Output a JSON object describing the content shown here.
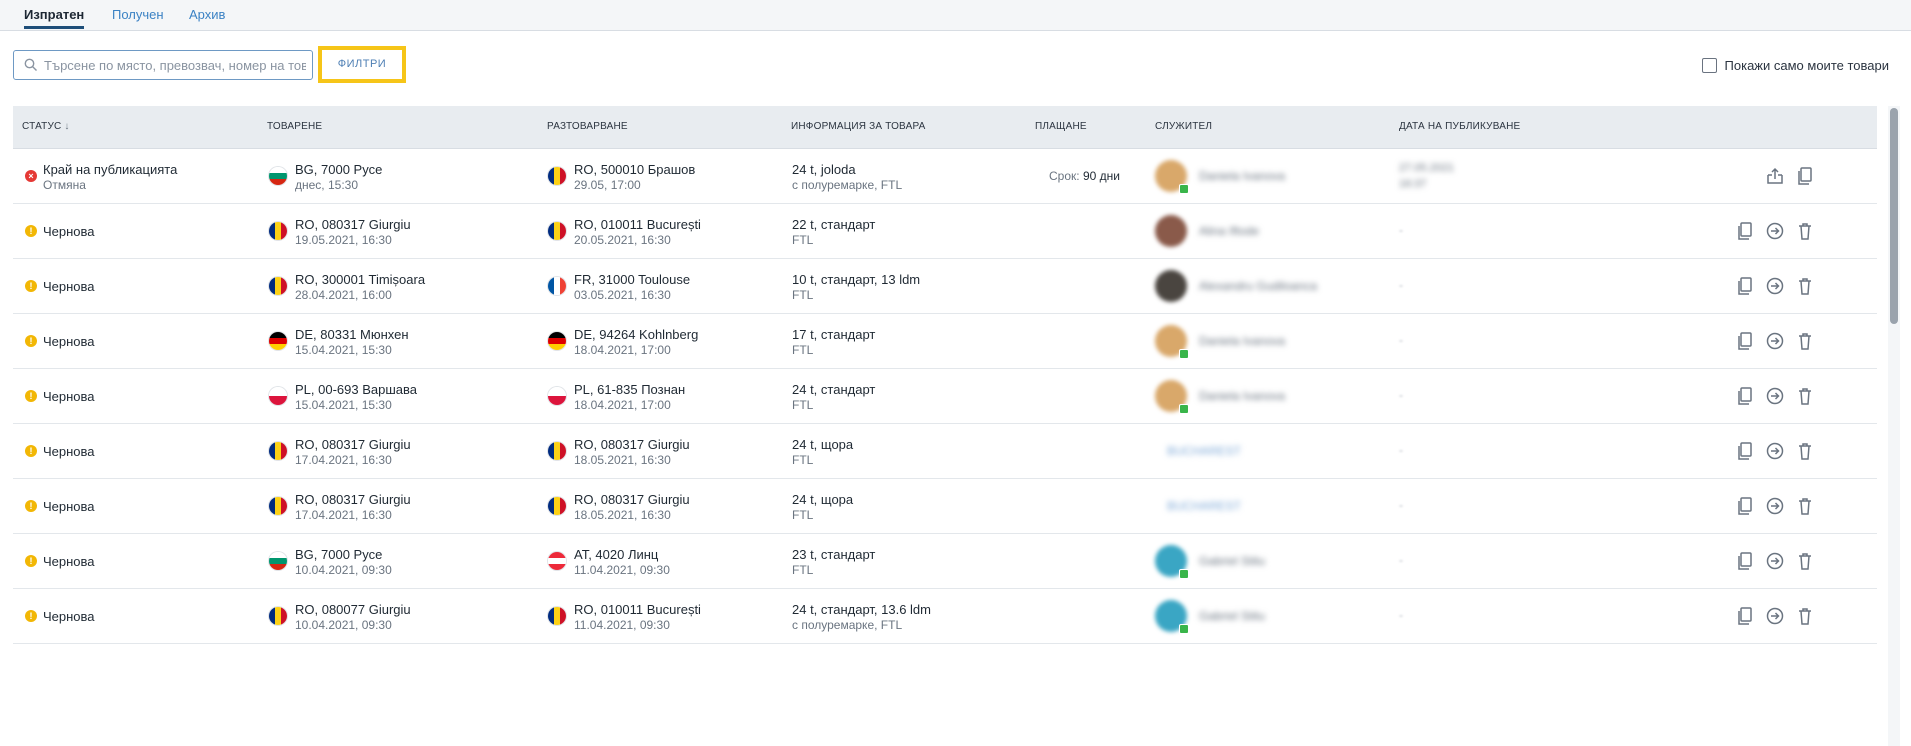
{
  "tabs": [
    {
      "label": "Изпратен",
      "active": true
    },
    {
      "label": "Получен",
      "active": false
    },
    {
      "label": "Архив",
      "active": false
    }
  ],
  "toolbar": {
    "search_placeholder": "Търсене по място, превозвач, номер на товар...",
    "search_value": "",
    "filters_label": "ФИЛТРИ",
    "show_mine_label": "Покажи само моите товари",
    "show_mine_checked": false
  },
  "table": {
    "headers": {
      "status": "СТАТУС",
      "loading": "ТОВАРЕНЕ",
      "unloading": "РАЗТОВАРВАНЕ",
      "cargo": "ИНФОРМАЦИЯ ЗА ТОВАРА",
      "payment": "ПЛАЩАНЕ",
      "employee": "СЛУЖИТЕЛ",
      "published": "ДАТА НА ПУБЛИКУВАНЕ"
    },
    "sort_indicator": "↓",
    "rows": [
      {
        "status": "Край на публикацията",
        "status_sub": "Отмяна",
        "status_type": "error",
        "load": "BG, 7000 Русе",
        "load_date": "днес, 15:30",
        "load_flag": "bg",
        "unload": "RO, 500010 Брашов",
        "unload_date": "29.05, 17:00",
        "unload_flag": "ro",
        "cargo": "24 t, joloda",
        "cargo_sub": "с полуремарке, FTL",
        "payment_label": "Срок:",
        "payment_value": "90 дни",
        "employee": "Daniela Ivanova",
        "employee_avatar": "#d9a86a",
        "employee_online": true,
        "published": "27.05.2021",
        "published_time": "16:37",
        "actions": [
          "repost-icon",
          "copy-icon"
        ]
      },
      {
        "status": "Чернова",
        "status_sub": "",
        "status_type": "warning",
        "load": "RO, 080317 Giurgiu",
        "load_date": "19.05.2021, 16:30",
        "load_flag": "ro",
        "unload": "RO, 010011 București",
        "unload_date": "20.05.2021, 16:30",
        "unload_flag": "ro",
        "cargo": "22 t, стандарт",
        "cargo_sub": "FTL",
        "payment_label": "",
        "payment_value": "",
        "employee": "Alina Iftode",
        "employee_avatar": "#8a5a4a",
        "employee_online": false,
        "published": "-",
        "published_time": "",
        "actions": [
          "copy-icon",
          "publish-icon",
          "delete-icon"
        ]
      },
      {
        "status": "Чернова",
        "status_sub": "",
        "status_type": "warning",
        "load": "RO, 300001 Timișoara",
        "load_date": "28.04.2021, 16:00",
        "load_flag": "ro",
        "unload": "FR, 31000 Toulouse",
        "unload_date": "03.05.2021, 16:30",
        "unload_flag": "fr",
        "cargo": "10 t, стандарт, 13 ldm",
        "cargo_sub": "FTL",
        "payment_label": "",
        "payment_value": "",
        "employee": "Alexandru Gudiloanca",
        "employee_avatar": "#4a4540",
        "employee_online": false,
        "published": "-",
        "published_time": "",
        "actions": [
          "copy-icon",
          "publish-icon",
          "delete-icon"
        ]
      },
      {
        "status": "Чернова",
        "status_sub": "",
        "status_type": "warning",
        "load": "DE, 80331 Мюнхен",
        "load_date": "15.04.2021, 15:30",
        "load_flag": "de",
        "unload": "DE, 94264 Kohlnberg",
        "unload_date": "18.04.2021, 17:00",
        "unload_flag": "de",
        "cargo": "17 t, стандарт",
        "cargo_sub": "FTL",
        "payment_label": "",
        "payment_value": "",
        "employee": "Daniela Ivanova",
        "employee_avatar": "#d9a86a",
        "employee_online": true,
        "published": "-",
        "published_time": "",
        "actions": [
          "copy-icon",
          "publish-icon",
          "delete-icon"
        ]
      },
      {
        "status": "Чернова",
        "status_sub": "",
        "status_type": "warning",
        "load": "PL, 00-693 Варшава",
        "load_date": "15.04.2021, 15:30",
        "load_flag": "pl",
        "unload": "PL, 61-835 Познан",
        "unload_date": "18.04.2021, 17:00",
        "unload_flag": "pl",
        "cargo": "24 t, стандарт",
        "cargo_sub": "FTL",
        "payment_label": "",
        "payment_value": "",
        "employee": "Daniela Ivanova",
        "employee_avatar": "#d9a86a",
        "employee_online": true,
        "published": "-",
        "published_time": "",
        "actions": [
          "copy-icon",
          "publish-icon",
          "delete-icon"
        ]
      },
      {
        "status": "Чернова",
        "status_sub": "",
        "status_type": "warning",
        "load": "RO, 080317 Giurgiu",
        "load_date": "17.04.2021, 16:30",
        "load_flag": "ro",
        "unload": "RO, 080317 Giurgiu",
        "unload_date": "18.05.2021, 16:30",
        "unload_flag": "ro",
        "cargo": "24 t, щора",
        "cargo_sub": "FTL",
        "payment_label": "",
        "payment_value": "",
        "employee": "BUCHAREST",
        "employee_avatar": "",
        "employee_online": false,
        "published": "-",
        "published_time": "",
        "actions": [
          "copy-icon",
          "publish-icon",
          "delete-icon"
        ]
      },
      {
        "status": "Чернова",
        "status_sub": "",
        "status_type": "warning",
        "load": "RO, 080317 Giurgiu",
        "load_date": "17.04.2021, 16:30",
        "load_flag": "ro",
        "unload": "RO, 080317 Giurgiu",
        "unload_date": "18.05.2021, 16:30",
        "unload_flag": "ro",
        "cargo": "24 t, щора",
        "cargo_sub": "FTL",
        "payment_label": "",
        "payment_value": "",
        "employee": "BUCHAREST",
        "employee_avatar": "",
        "employee_online": false,
        "published": "-",
        "published_time": "",
        "actions": [
          "copy-icon",
          "publish-icon",
          "delete-icon"
        ]
      },
      {
        "status": "Чернова",
        "status_sub": "",
        "status_type": "warning",
        "load": "BG, 7000 Русе",
        "load_date": "10.04.2021, 09:30",
        "load_flag": "bg",
        "unload": "AT, 4020 Линц",
        "unload_date": "11.04.2021, 09:30",
        "unload_flag": "at",
        "cargo": "23 t, стандарт",
        "cargo_sub": "FTL",
        "payment_label": "",
        "payment_value": "",
        "employee": "Gabriel Stitu",
        "employee_avatar": "#3aa6c4",
        "employee_online": true,
        "published": "-",
        "published_time": "",
        "actions": [
          "copy-icon",
          "publish-icon",
          "delete-icon"
        ]
      },
      {
        "status": "Чернова",
        "status_sub": "",
        "status_type": "warning",
        "load": "RO, 080077 Giurgiu",
        "load_date": "10.04.2021, 09:30",
        "load_flag": "ro",
        "unload": "RO, 010011 București",
        "unload_date": "11.04.2021, 09:30",
        "unload_flag": "ro",
        "cargo": "24 t, стандарт, 13.6 ldm",
        "cargo_sub": "с полуремарке, FTL",
        "payment_label": "",
        "payment_value": "",
        "employee": "Gabriel Stitu",
        "employee_avatar": "#3aa6c4",
        "employee_online": true,
        "published": "-",
        "published_time": "",
        "actions": [
          "copy-icon",
          "publish-icon",
          "delete-icon"
        ]
      }
    ]
  },
  "colors": {
    "accent": "#3b82c4",
    "highlight": "#f6c518",
    "error": "#e53935",
    "warning": "#f2b705",
    "online": "#39b54a"
  }
}
